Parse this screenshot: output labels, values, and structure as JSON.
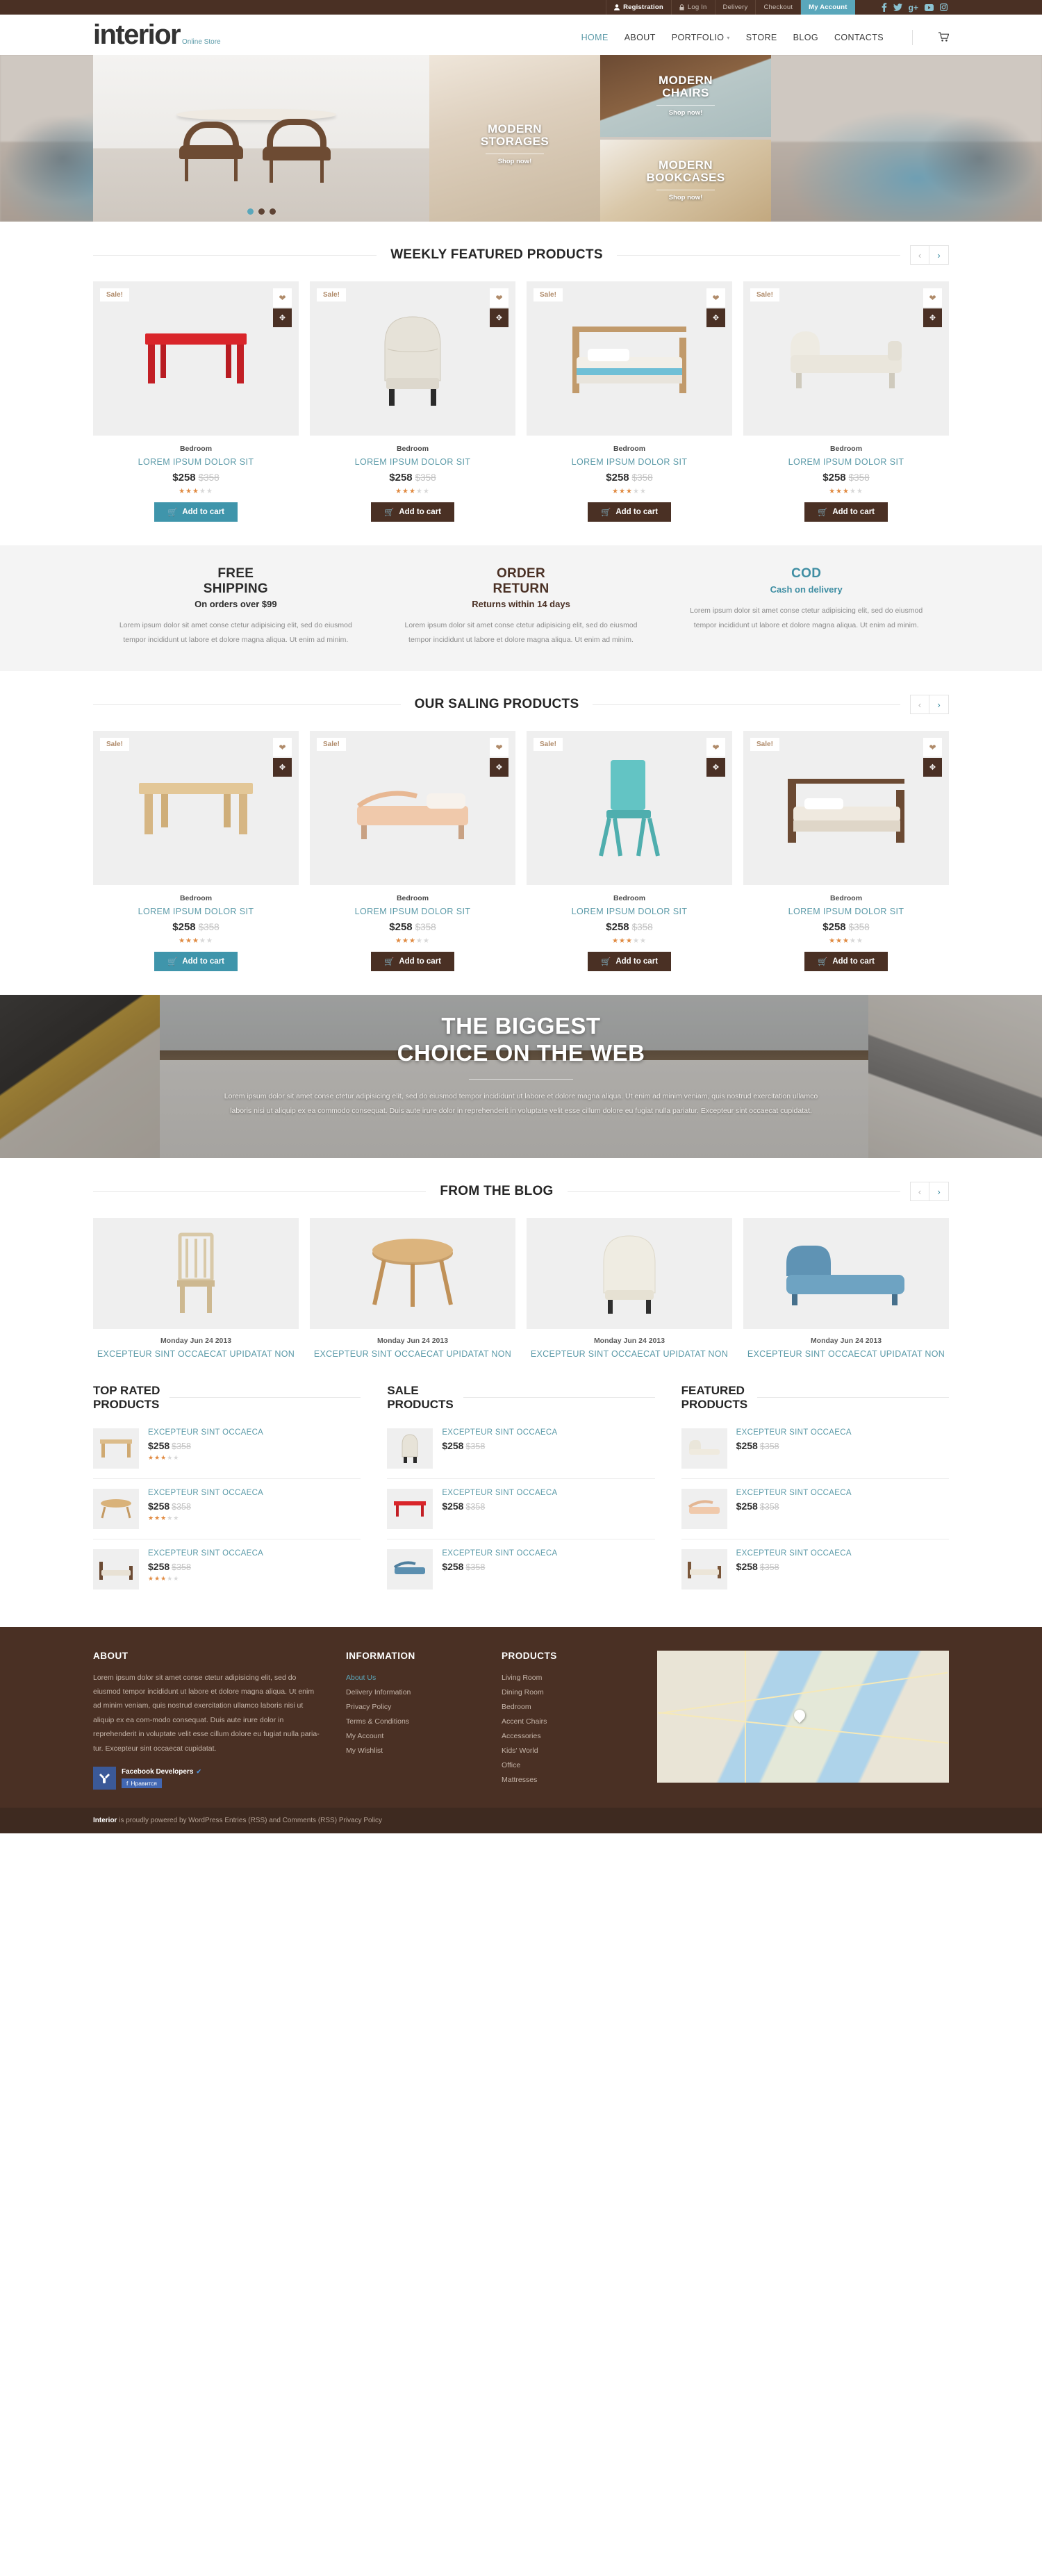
{
  "topbar": {
    "links": [
      {
        "label": "Registration",
        "icon": "user-icon",
        "style": "strong"
      },
      {
        "label": "Log In",
        "icon": "lock-icon",
        "style": "normal"
      },
      {
        "label": "Delivery",
        "icon": "",
        "style": "normal"
      },
      {
        "label": "Checkout",
        "icon": "",
        "style": "normal"
      },
      {
        "label": "My Account",
        "icon": "",
        "style": "account"
      }
    ],
    "social": [
      {
        "name": "facebook-icon",
        "glyph": "f"
      },
      {
        "name": "twitter-icon",
        "glyph": "✉"
      },
      {
        "name": "google-plus-icon",
        "glyph": "g+"
      },
      {
        "name": "youtube-icon",
        "glyph": "▶"
      },
      {
        "name": "instagram-icon",
        "glyph": "▣"
      }
    ]
  },
  "header": {
    "logo_main": "interior",
    "logo_sub": "Online Store",
    "nav": [
      {
        "label": "HOME",
        "active": true,
        "caret": false
      },
      {
        "label": "ABOUT",
        "active": false,
        "caret": false
      },
      {
        "label": "PORTFOLIO",
        "active": false,
        "caret": true
      },
      {
        "label": "STORE",
        "active": false,
        "caret": false
      },
      {
        "label": "BLOG",
        "active": false,
        "caret": false
      },
      {
        "label": "CONTACTS",
        "active": false,
        "caret": false
      }
    ],
    "cart_icon": "cart-icon"
  },
  "hero": {
    "tiles": [
      {
        "title": "MODERN\nSTORAGES",
        "cta": "Shop now!"
      },
      {
        "title": "MODERN\nCHAIRS",
        "cta": "Shop now!"
      },
      {
        "title": "MODERN\nBOOKCASES",
        "cta": "Shop now!"
      }
    ],
    "dots": 3,
    "active_dot": 0
  },
  "featured": {
    "title": "WEEKLY FEATURED PRODUCTS",
    "prev": "‹",
    "next": "›",
    "products": [
      {
        "badge": "Sale!",
        "category": "Bedroom",
        "name": "LOREM IPSUM DOLOR SIT",
        "price": "$258",
        "old_price": "$358",
        "rating": 3,
        "button": "Add to cart",
        "button_style": "teal"
      },
      {
        "badge": "Sale!",
        "category": "Bedroom",
        "name": "LOREM IPSUM DOLOR SIT",
        "price": "$258",
        "old_price": "$358",
        "rating": 3,
        "button": "Add to cart",
        "button_style": "brown"
      },
      {
        "badge": "Sale!",
        "category": "Bedroom",
        "name": "LOREM IPSUM DOLOR SIT",
        "price": "$258",
        "old_price": "$358",
        "rating": 3,
        "button": "Add to cart",
        "button_style": "brown"
      },
      {
        "badge": "Sale!",
        "category": "Bedroom",
        "name": "LOREM IPSUM DOLOR SIT",
        "price": "$258",
        "old_price": "$358",
        "rating": 3,
        "button": "Add to cart",
        "button_style": "brown"
      }
    ]
  },
  "services": [
    {
      "heading": "FREE\nSHIPPING",
      "sub": "On orders over $99",
      "color": "dark",
      "text": "Lorem ipsum dolor sit amet conse ctetur adipisicing elit, sed do eiusmod tempor incididunt ut labore et dolore magna aliqua. Ut enim ad minim."
    },
    {
      "heading": "ORDER\nRETURN",
      "sub": "Returns within 14 days",
      "color": "brown",
      "text": "Lorem ipsum dolor sit amet conse ctetur adipisicing elit, sed do eiusmod tempor incididunt ut labore et dolore magna aliqua. Ut enim ad minim."
    },
    {
      "heading": "COD",
      "sub": "Cash on delivery",
      "color": "teal",
      "text": "Lorem ipsum dolor sit amet conse ctetur adipisicing elit, sed do eiusmod tempor incididunt ut labore et dolore magna aliqua. Ut enim ad minim."
    }
  ],
  "saling": {
    "title": "OUR SALING PRODUCTS",
    "prev": "‹",
    "next": "›",
    "products": [
      {
        "badge": "Sale!",
        "category": "Bedroom",
        "name": "LOREM IPSUM DOLOR SIT",
        "price": "$258",
        "old_price": "$358",
        "rating": 3,
        "button": "Add to cart",
        "button_style": "teal"
      },
      {
        "badge": "Sale!",
        "category": "Bedroom",
        "name": "LOREM IPSUM DOLOR SIT",
        "price": "$258",
        "old_price": "$358",
        "rating": 3,
        "button": "Add to cart",
        "button_style": "brown"
      },
      {
        "badge": "Sale!",
        "category": "Bedroom",
        "name": "LOREM IPSUM DOLOR SIT",
        "price": "$258",
        "old_price": "$358",
        "rating": 3,
        "button": "Add to cart",
        "button_style": "brown"
      },
      {
        "badge": "Sale!",
        "category": "Bedroom",
        "name": "LOREM IPSUM DOLOR SIT",
        "price": "$258",
        "old_price": "$358",
        "rating": 3,
        "button": "Add to cart",
        "button_style": "brown"
      }
    ]
  },
  "promo": {
    "heading": "THE BIGGEST\nCHOICE ON THE WEB",
    "text": "Lorem ipsum dolor sit amet conse ctetur adipisicing elit, sed do eiusmod tempor incididunt ut labore et dolore magna aliqua. Ut enim ad minim veniam, quis nostrud exercitation ullamco laboris nisi ut aliquip ex ea commodo consequat. Duis aute irure dolor in reprehenderit in voluptate velit esse cillum dolore eu fugiat nulla pariatur. Excepteur sint occaecat cupidatat."
  },
  "blog": {
    "title": "FROM THE BLOG",
    "prev": "‹",
    "next": "›",
    "posts": [
      {
        "date": "Monday Jun 24 2013",
        "title": "EXCEPTEUR SINT OCCAECAT UPIDATAT NON"
      },
      {
        "date": "Monday Jun 24 2013",
        "title": "EXCEPTEUR SINT OCCAECAT UPIDATAT NON"
      },
      {
        "date": "Monday Jun 24 2013",
        "title": "EXCEPTEUR SINT OCCAECAT UPIDATAT NON"
      },
      {
        "date": "Monday Jun 24 2013",
        "title": "EXCEPTEUR SINT OCCAECAT UPIDATAT NON"
      }
    ]
  },
  "lists": [
    {
      "title": "TOP RATED\nPRODUCTS",
      "show_stars": true,
      "items": [
        {
          "name": "EXCEPTEUR SINT OCCAECA",
          "price": "$258",
          "old_price": "$358",
          "rating": 3
        },
        {
          "name": "EXCEPTEUR SINT OCCAECA",
          "price": "$258",
          "old_price": "$358",
          "rating": 3
        },
        {
          "name": "EXCEPTEUR SINT OCCAECA",
          "price": "$258",
          "old_price": "$358",
          "rating": 3
        }
      ]
    },
    {
      "title": "SALE\nPRODUCTS",
      "show_stars": false,
      "items": [
        {
          "name": "EXCEPTEUR SINT OCCAECA",
          "price": "$258",
          "old_price": "$358",
          "rating": 0
        },
        {
          "name": "EXCEPTEUR SINT OCCAECA",
          "price": "$258",
          "old_price": "$358",
          "rating": 0
        },
        {
          "name": "EXCEPTEUR SINT OCCAECA",
          "price": "$258",
          "old_price": "$358",
          "rating": 0
        }
      ]
    },
    {
      "title": "FEATURED\nPRODUCTS",
      "show_stars": false,
      "items": [
        {
          "name": "EXCEPTEUR SINT OCCAECA",
          "price": "$258",
          "old_price": "$358",
          "rating": 0
        },
        {
          "name": "EXCEPTEUR SINT OCCAECA",
          "price": "$258",
          "old_price": "$358",
          "rating": 0
        },
        {
          "name": "EXCEPTEUR SINT OCCAECA",
          "price": "$258",
          "old_price": "$358",
          "rating": 0
        }
      ]
    }
  ],
  "footer": {
    "about": {
      "heading": "ABOUT",
      "text": "Lorem ipsum dolor sit amet conse ctetur adipisicing elit, sed do eiusmod tempor incididunt ut labore et dolore magna aliqua. Ut enim ad minim veniam, quis nostrud exercitation ullamco laboris nisi ut aliquip ex ea com-modo consequat. Duis aute irure dolor in reprehenderit in voluptate velit esse cillum dolore eu fugiat nulla paria-tur. Excepteur sint occaecat cupidatat.",
      "fb_name": "Facebook Developers",
      "fb_like": "Нравится"
    },
    "information": {
      "heading": "INFORMATION",
      "links": [
        {
          "label": "About Us",
          "active": true
        },
        {
          "label": "Delivery Information",
          "active": false
        },
        {
          "label": "Privacy Policy",
          "active": false
        },
        {
          "label": "Terms & Conditions",
          "active": false
        },
        {
          "label": "My Account",
          "active": false
        },
        {
          "label": "My Wishlist",
          "active": false
        }
      ]
    },
    "products": {
      "heading": "PRODUCTS",
      "links": [
        {
          "label": "Living Room"
        },
        {
          "label": "Dining Room"
        },
        {
          "label": "Bedroom"
        },
        {
          "label": "Accent Chairs"
        },
        {
          "label": "Accessories"
        },
        {
          "label": "Kids' World"
        },
        {
          "label": "Office"
        },
        {
          "label": "Mattresses"
        }
      ]
    },
    "copyright_brand": "Interior",
    "copyright_rest": " is proudly powered by WordPress Entries (RSS) and Comments (RSS) Privacy Policy"
  },
  "colors": {
    "brown": "#4a3024",
    "teal": "#5aa7bb",
    "teal_dark": "#3f8ea3",
    "star": "#e08a41"
  }
}
